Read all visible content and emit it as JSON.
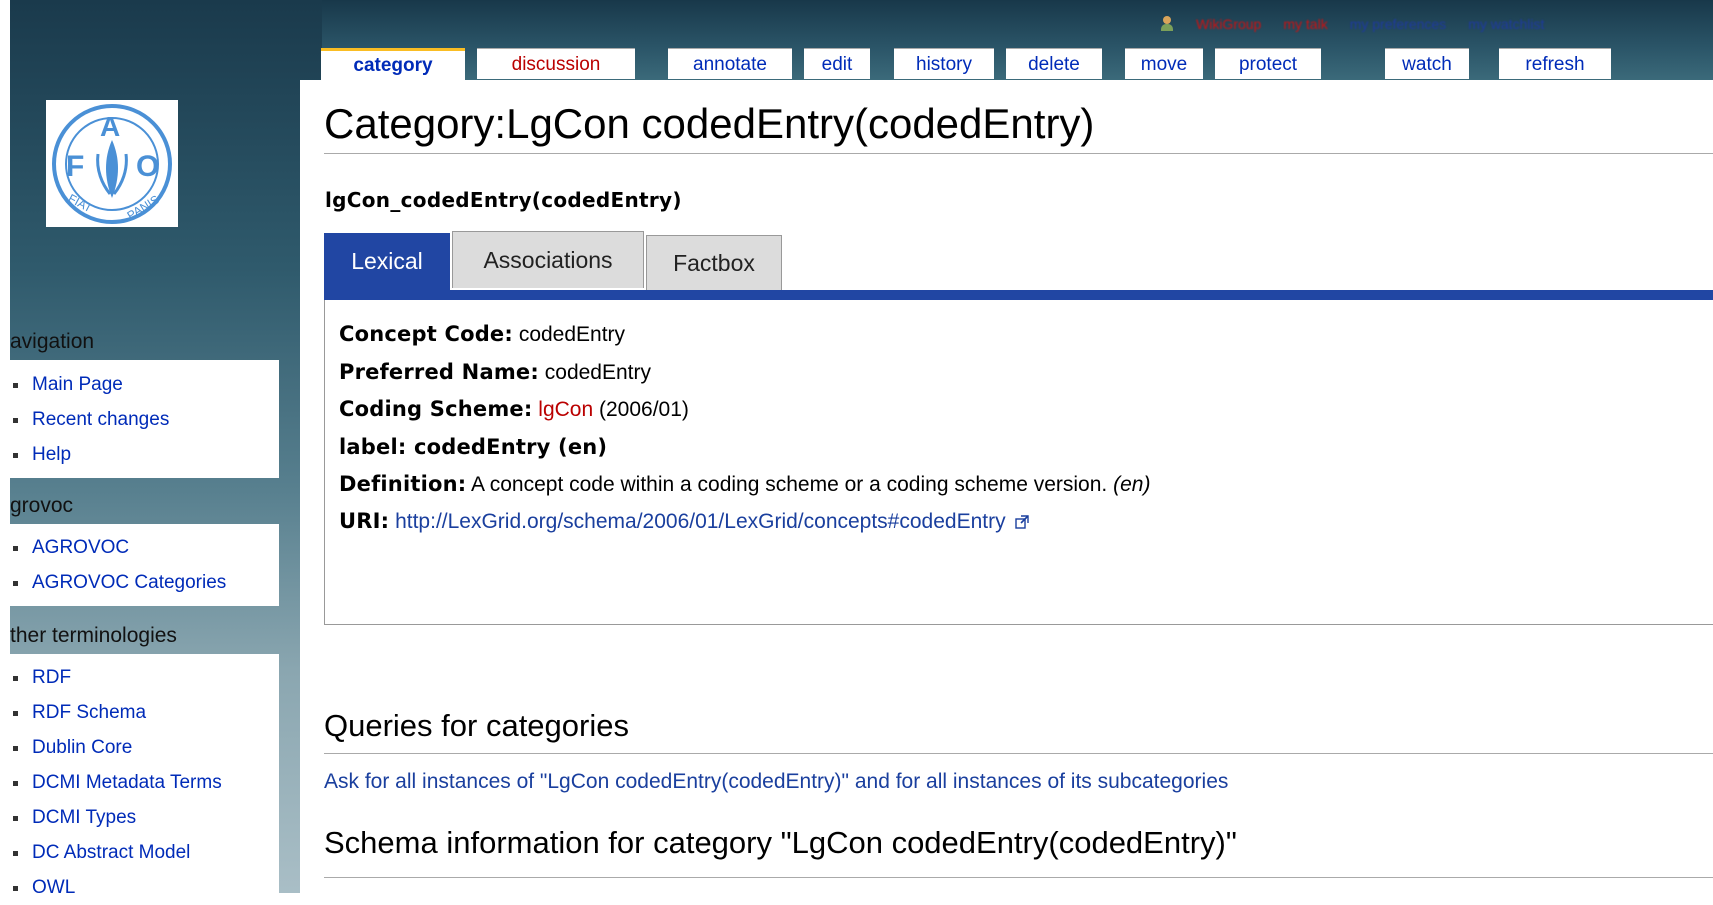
{
  "personal": {
    "user": "WikiGroup",
    "talk": "my talk",
    "prefs": "my preferences",
    "logout": "my watchlist"
  },
  "tabs": [
    {
      "label": "category"
    },
    {
      "label": "discussion"
    },
    {
      "label": "annotate"
    },
    {
      "label": "edit"
    },
    {
      "label": "history"
    },
    {
      "label": "delete"
    },
    {
      "label": "move"
    },
    {
      "label": "protect"
    },
    {
      "label": "watch"
    },
    {
      "label": "refresh"
    }
  ],
  "sidebar": {
    "logo_text": "FIAT PANIS",
    "portlets": [
      {
        "title": "avigation",
        "items": [
          "Main Page",
          "Recent changes",
          "Help"
        ]
      },
      {
        "title": "grovoc",
        "items": [
          "AGROVOC",
          "AGROVOC Categories"
        ]
      },
      {
        "title": "ther terminologies",
        "items": [
          "RDF",
          "RDF Schema",
          "Dublin Core",
          "DCMI Metadata Terms",
          "DCMI Types",
          "DC Abstract Model",
          "OWL"
        ]
      }
    ]
  },
  "page": {
    "title": "Category:LgCon codedEntry(codedEntry)",
    "subtitle": "lgCon_codedEntry(codedEntry)",
    "content_tabs": [
      "Lexical",
      "Associations",
      "Factbox"
    ],
    "props": {
      "concept_code_key": "Concept Code:",
      "concept_code_val": " codedEntry",
      "preferred_name_key": "Preferred Name:",
      "preferred_name_val": " codedEntry",
      "coding_scheme_key": "Coding Scheme:",
      "coding_scheme_link": "lgCon",
      "coding_scheme_ver": " (2006/01)",
      "label_key": "label:",
      "label_val": " codedEntry (en)",
      "definition_key": "Definition:",
      "definition_val": " A concept code within a coding scheme or a coding scheme version. ",
      "definition_lang": "(en)",
      "uri_key": "URI:",
      "uri_val": "http://LexGrid.org/schema/2006/01/LexGrid/concepts#codedEntry"
    },
    "queries_heading": "Queries for categories",
    "ask_link": "Ask for all instances of \"LgCon codedEntry(codedEntry)\" and for all instances of its subcategories",
    "schema_heading": "Schema information for category \"LgCon codedEntry(codedEntry)\""
  }
}
